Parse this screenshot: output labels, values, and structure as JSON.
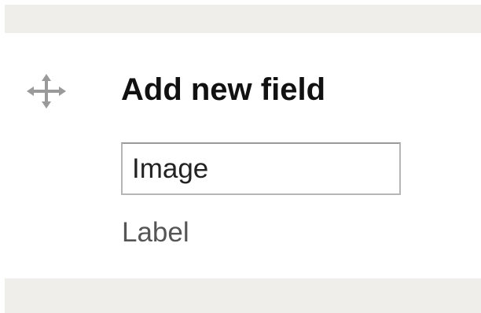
{
  "new_field": {
    "title": "Add new field",
    "label_input": {
      "value": "Image",
      "placeholder": ""
    },
    "description": "Label"
  },
  "icons": {
    "drag_handle": "move-arrows-icon"
  },
  "colors": {
    "band_background": "#efeeea",
    "title_text": "#111111",
    "description_text": "#555555",
    "input_border": "#b6b6b6",
    "icon": "#9a9a9a"
  }
}
